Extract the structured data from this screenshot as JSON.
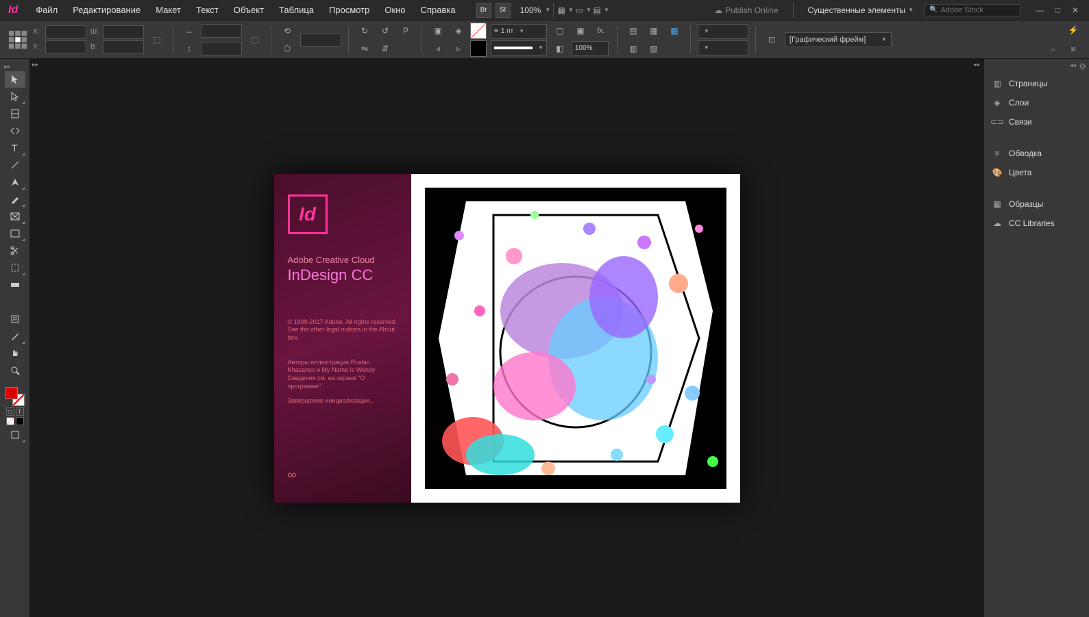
{
  "app": {
    "logo": "Id"
  },
  "menu": [
    "Файл",
    "Редактирование",
    "Макет",
    "Текст",
    "Объект",
    "Таблица",
    "Просмотр",
    "Окно",
    "Справка"
  ],
  "topbar": {
    "br": "Br",
    "st": "St",
    "zoom": "100%",
    "publish": "Publish Online",
    "workspace": "Существенные элементы",
    "search_placeholder": "Adobe Stock"
  },
  "control": {
    "x_label": "X:",
    "y_label": "Y:",
    "w_label": "Ш:",
    "h_label": "В:",
    "stroke_value": "1 пт",
    "percent": "100%",
    "frame_type": "[Графический фрейм]"
  },
  "panels": {
    "group1": [
      "Страницы",
      "Слои",
      "Связи"
    ],
    "group2": [
      "Обводка",
      "Цвета"
    ],
    "group3": [
      "Образцы",
      "CC Libraries"
    ]
  },
  "splash": {
    "logo": "Id",
    "cc": "Adobe Creative Cloud",
    "name": "InDesign CC",
    "copyright": "© 1999-2017 Adobe. All rights reserved. See the other legal notices in the About box.",
    "credits": "Авторы иллюстрации Ruslan Khasanov и My Name is Wendy Сведения см. на экране \"О программе\".",
    "init": "Завершение инициализации..."
  }
}
